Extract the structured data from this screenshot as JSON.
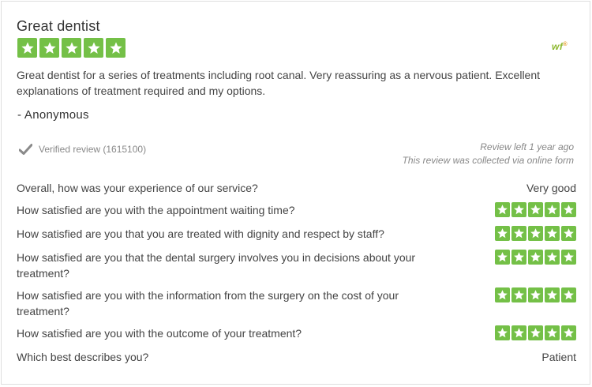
{
  "review": {
    "title": "Great dentist",
    "rating": 5,
    "body": "Great dentist for a series of treatments including root canal. Very reassuring as a nervous patient. Excellent explanations of treatment required and my options.",
    "author": "- Anonymous",
    "verified": "Verified review (1615100)",
    "left": "Review left 1 year ago",
    "collected": "This review was collected via online form"
  },
  "logo": {
    "text": "wf",
    "mark": "®"
  },
  "questions": [
    {
      "question": "Overall, how was your experience of our service?",
      "answer": "Very good"
    },
    {
      "question": "How satisfied are you with the appointment waiting time?",
      "rating": 5
    },
    {
      "question": "How satisfied are you that you are treated with dignity and respect by staff?",
      "rating": 5
    },
    {
      "question": "How satisfied are you that the dental surgery involves you in decisions about your treatment?",
      "rating": 5
    },
    {
      "question": "How satisfied are you with the information from the surgery on the cost of your treatment?",
      "rating": 5
    },
    {
      "question": "How satisfied are you with the outcome of your treatment?",
      "rating": 5
    },
    {
      "question": "Which best describes you?",
      "answer": "Patient"
    }
  ],
  "colors": {
    "star_green": "#74c047",
    "text": "#444444",
    "muted": "#888888"
  },
  "icons": {
    "star": "star-icon",
    "verified": "checkmark-icon"
  }
}
